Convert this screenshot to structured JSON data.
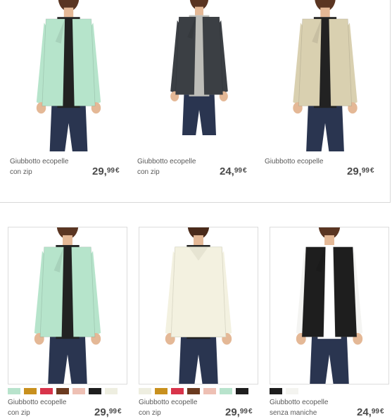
{
  "top_row": [
    {
      "name": "Giubbotto ecopelle",
      "subtitle": "con zip",
      "price_int": "29,",
      "price_cents": "99",
      "currency": "€",
      "jacket_color": "#b6e4cb",
      "image": "mint-jacket-photo"
    },
    {
      "name": "Giubbotto ecopelle",
      "subtitle": "con zip",
      "price_int": "24,",
      "price_cents": "99",
      "currency": "€",
      "jacket_color": "#3b3f44",
      "image": "dark-jacket-photo"
    },
    {
      "name": "Giubbotto ecopelle",
      "subtitle": "",
      "price_int": "29,",
      "price_cents": "99",
      "currency": "€",
      "jacket_color": "#d9d0b0",
      "image": "beige-jacket-photo"
    }
  ],
  "bottom_row": [
    {
      "name": "Giubbotto ecopelle",
      "subtitle": "con zip",
      "price_int": "29,",
      "price_cents": "99",
      "currency": "€",
      "jacket_color": "#b6e4cb",
      "image": "mint-jacket-photo",
      "swatches": [
        "#b8e3cc",
        "#c8901e",
        "#d8344a",
        "#6b3a1f",
        "#eec0b4",
        "#1e1e1e",
        "#eeeee0"
      ]
    },
    {
      "name": "Giubbotto ecopelle",
      "subtitle": "con zip",
      "price_int": "29,",
      "price_cents": "99",
      "currency": "€",
      "jacket_color": "#f3f1e0",
      "image": "cream-jacket-back-photo",
      "swatches": [
        "#eeeee0",
        "#c8901e",
        "#d8344a",
        "#6b3a1f",
        "#eec0b4",
        "#b8e3cc",
        "#1e1e1e"
      ]
    },
    {
      "name": "Giubbotto ecopelle",
      "subtitle": "senza maniche",
      "price_int": "24,",
      "price_cents": "99",
      "currency": "€",
      "jacket_color": "#1e1e1e",
      "image": "black-vest-photo",
      "swatches": [
        "#1e1e1e",
        "#f4f4f0"
      ]
    }
  ]
}
